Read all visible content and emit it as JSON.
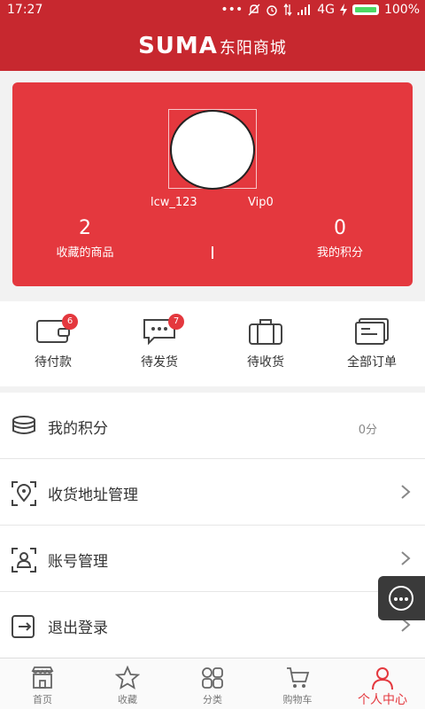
{
  "status_bar": {
    "time": "17:27",
    "network": "4G",
    "battery": "100%",
    "icons": [
      "more-dots-icon",
      "mute-icon",
      "alarm-icon",
      "data-icon",
      "signal-icon",
      "charging-icon",
      "battery-icon"
    ]
  },
  "header": {
    "brand_latin": "SUMA",
    "brand_cn": "东阳商城"
  },
  "profile": {
    "username": "lcw_123",
    "level": "Vip0",
    "favorites_count": "2",
    "favorites_label": "收藏的商品",
    "points_count": "0",
    "points_label": "我的积分",
    "divider": "|"
  },
  "orders": [
    {
      "label": "待付款",
      "badge": "6",
      "icon": "wallet-icon"
    },
    {
      "label": "待发货",
      "badge": "7",
      "icon": "chat-bubble-icon"
    },
    {
      "label": "待收货",
      "badge": "",
      "icon": "suitcase-icon"
    },
    {
      "label": "全部订单",
      "badge": "",
      "icon": "documents-icon"
    }
  ],
  "menu": [
    {
      "label": "我的积分",
      "value": "0分",
      "icon": "coins-stack-icon"
    },
    {
      "label": "收货地址管理",
      "value": "",
      "icon": "location-pin-icon"
    },
    {
      "label": "账号管理",
      "value": "",
      "icon": "user-account-icon"
    },
    {
      "label": "退出登录",
      "value": "",
      "icon": "logout-icon"
    }
  ],
  "tabs": [
    {
      "label": "首页",
      "icon": "home-store-icon"
    },
    {
      "label": "收藏",
      "icon": "star-icon"
    },
    {
      "label": "分类",
      "icon": "grid-icon"
    },
    {
      "label": "购物车",
      "icon": "cart-icon"
    },
    {
      "label": "个人中心",
      "icon": "person-icon",
      "active": true
    }
  ],
  "colors": {
    "brand_red": "#c7282f",
    "card_red": "#e4383e",
    "active_tab": "#e4383e"
  }
}
